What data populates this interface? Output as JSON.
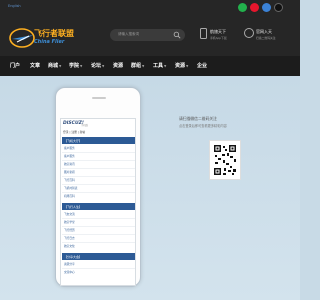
{
  "topbar": {
    "language_label": "English",
    "social_icons": [
      {
        "name": "wechat-icon",
        "color": "#22b14c"
      },
      {
        "name": "weibo-icon",
        "color": "#e6162d"
      },
      {
        "name": "qq-icon",
        "color": "#3b82d6"
      },
      {
        "name": "douyin-icon",
        "color": "#1b1b1b"
      }
    ]
  },
  "header": {
    "logo_cn": "飞行者联盟",
    "logo_en": "China Flier",
    "search_placeholder": "请输入搜索词",
    "app_title": "航旅天下",
    "app_sub": "手机App下载",
    "wechat_title": "官网入天",
    "wechat_sub": "扫描二维码关注"
  },
  "nav": {
    "items": [
      {
        "label": "门户",
        "caret": false
      },
      {
        "label": "文章",
        "caret": false
      },
      {
        "label": "商城",
        "caret": true
      },
      {
        "label": "学院",
        "caret": true
      },
      {
        "label": "论坛",
        "caret": true
      },
      {
        "label": "资源",
        "caret": false
      },
      {
        "label": "群组",
        "caret": true
      },
      {
        "label": "工具",
        "caret": true
      },
      {
        "label": "资源",
        "caret": true
      },
      {
        "label": "企业",
        "caret": false
      }
    ]
  },
  "phone": {
    "logo": "DISCUZ!",
    "logo_sub": "手机版",
    "user_line": "登录 | 注册 | 新帖",
    "sections": [
      {
        "title": "【飞机大厅】",
        "items": [
          "客户服务",
          "客户服务",
          "航空资讯",
          "图片新闻",
          "飞行百科",
          "飞机时刻表",
          "机场百科"
        ]
      },
      {
        "title": "【飞行人生】",
        "items": [
          "飞友交流",
          "航空学堂",
          "飞行经历",
          "飞行日志",
          "航空文化"
        ]
      },
      {
        "title": "【分享大会】",
        "items": [
          "资源分享",
          "交流中心"
        ]
      }
    ]
  },
  "info": {
    "title": "请扫描微信二维码关注",
    "desc": "点击登录后即可查看更多精彩内容"
  },
  "colors": {
    "accent": "#2c5a95",
    "header_bg": "#262626",
    "nav_bg": "#1c1c1c",
    "main_bg": "#c8dae6"
  }
}
